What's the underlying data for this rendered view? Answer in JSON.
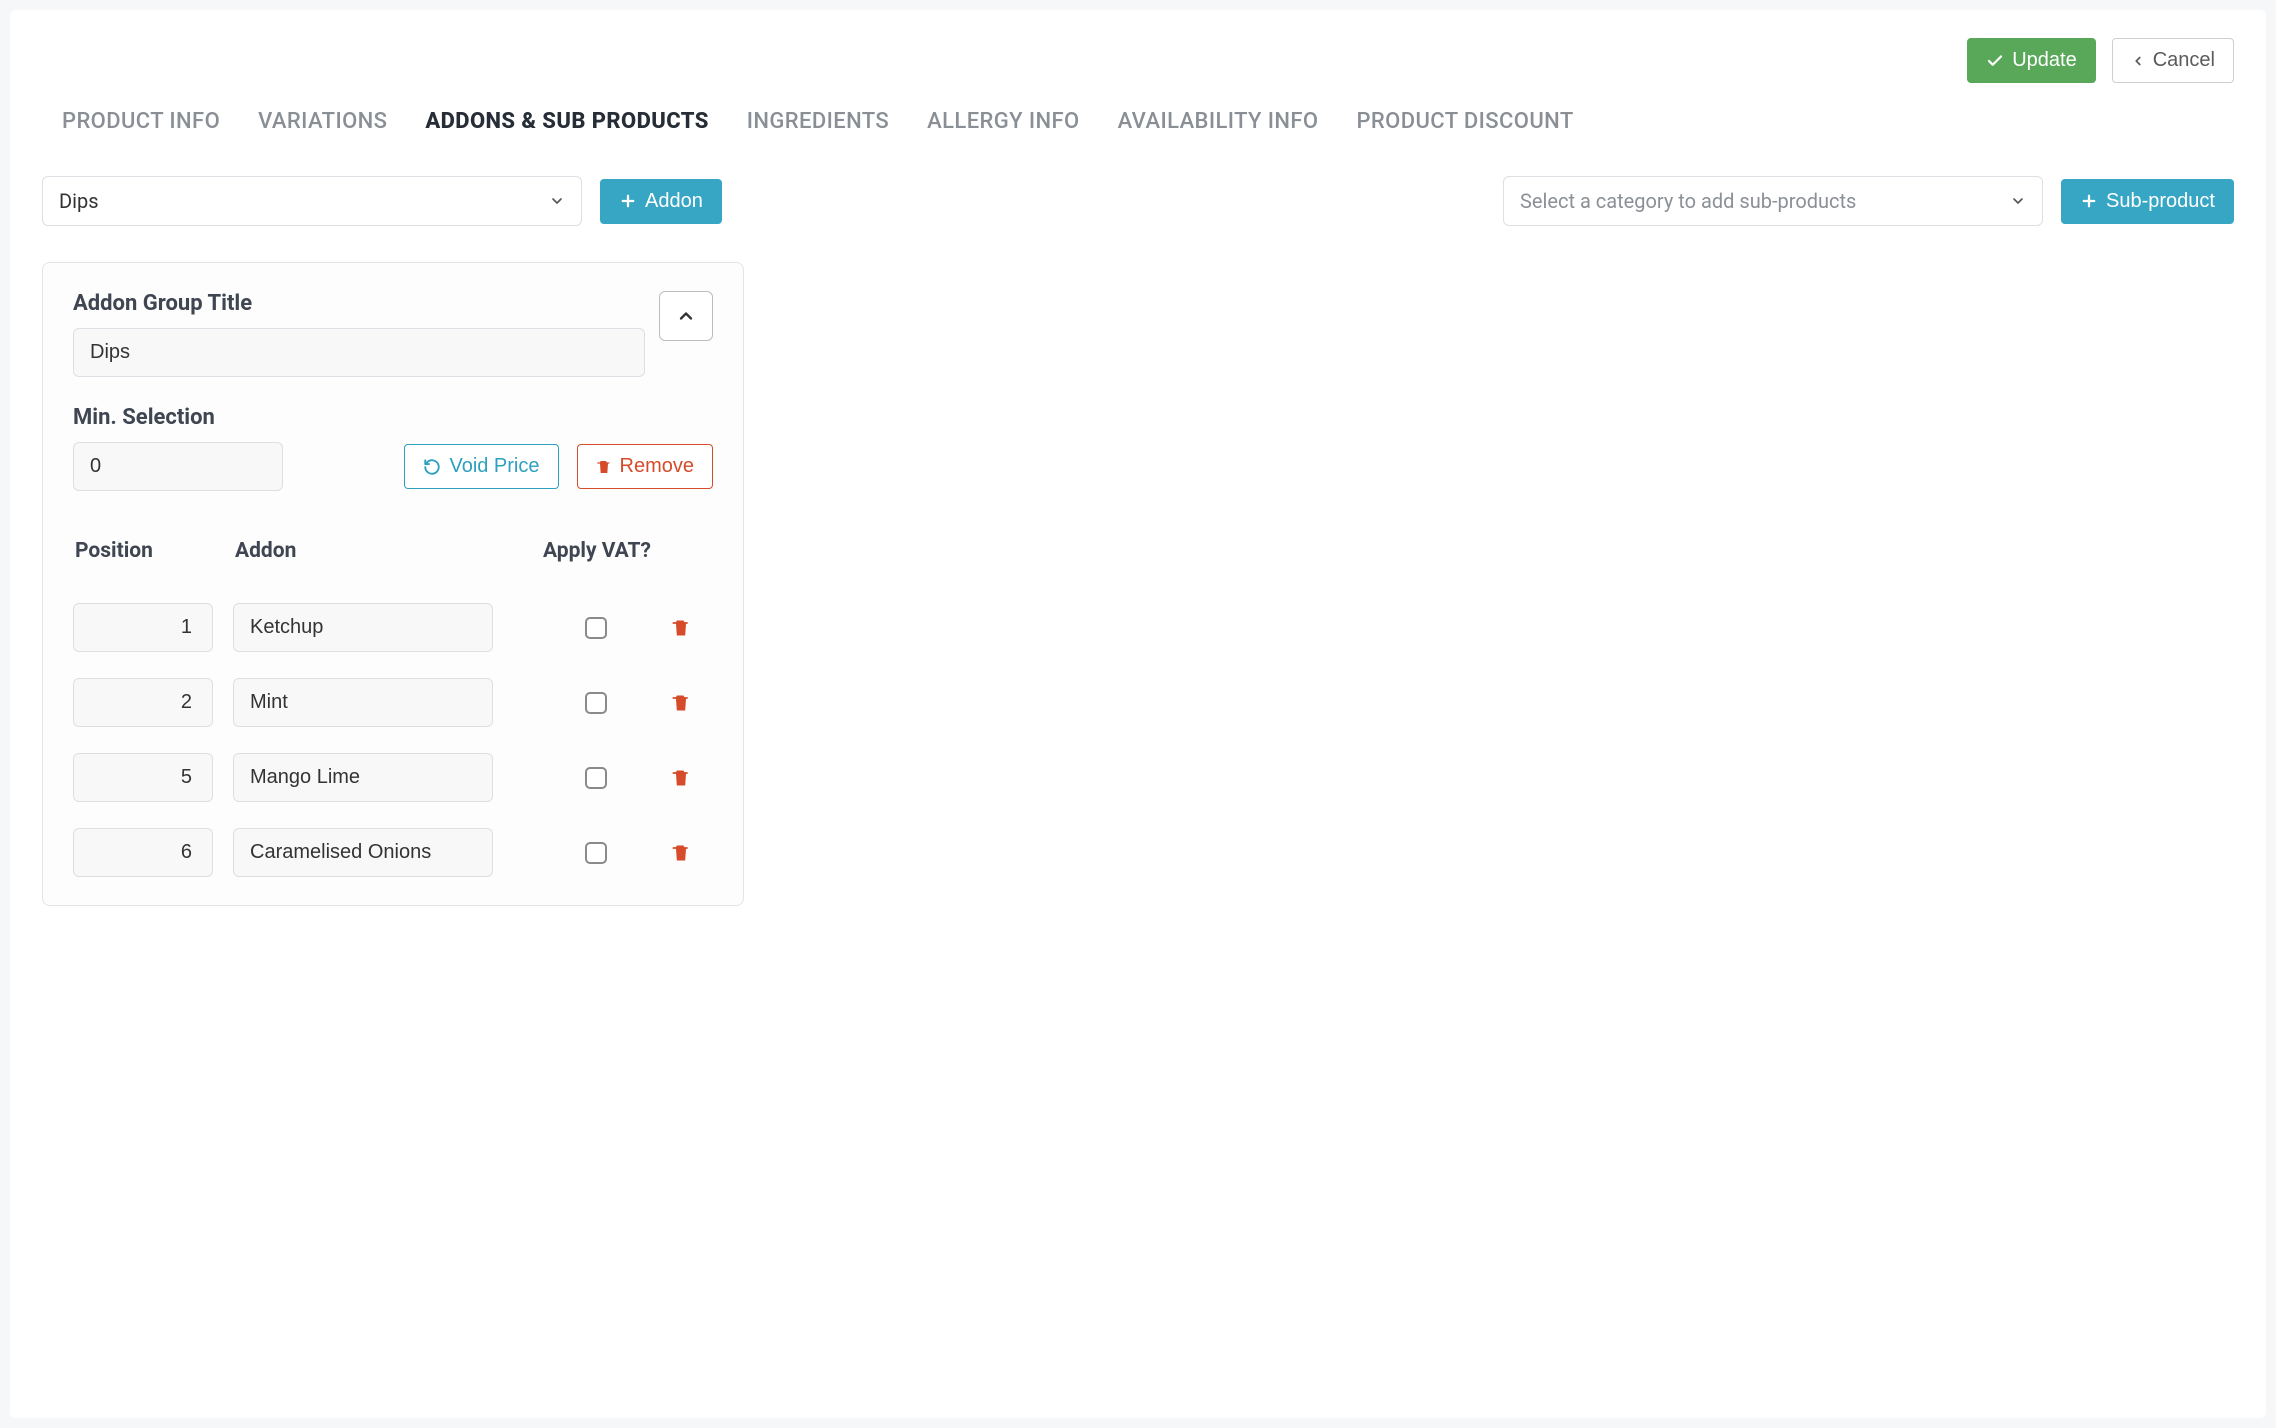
{
  "actions": {
    "update": "Update",
    "cancel": "Cancel"
  },
  "tabs": [
    {
      "label": "PRODUCT INFO",
      "active": false
    },
    {
      "label": "VARIATIONS",
      "active": false
    },
    {
      "label": "ADDONS & SUB PRODUCTS",
      "active": true
    },
    {
      "label": "INGREDIENTS",
      "active": false
    },
    {
      "label": "ALLERGY INFO",
      "active": false
    },
    {
      "label": "AVAILABILITY INFO",
      "active": false
    },
    {
      "label": "PRODUCT DISCOUNT",
      "active": false
    }
  ],
  "toolbar": {
    "addon_select_value": "Dips",
    "addon_button": "Addon",
    "subproduct_select_placeholder": "Select a category to add sub-products",
    "subproduct_button": "Sub-product"
  },
  "group": {
    "title_label": "Addon Group Title",
    "title_value": "Dips",
    "min_label": "Min. Selection",
    "min_value": "0",
    "void_price_label": "Void Price",
    "remove_label": "Remove",
    "columns": {
      "position": "Position",
      "addon": "Addon",
      "vat": "Apply VAT?"
    },
    "rows": [
      {
        "position": "1",
        "name": "Ketchup",
        "vat": false
      },
      {
        "position": "2",
        "name": "Mint",
        "vat": false
      },
      {
        "position": "5",
        "name": "Mango Lime",
        "vat": false
      },
      {
        "position": "6",
        "name": "Caramelised Onions",
        "vat": false
      }
    ]
  }
}
